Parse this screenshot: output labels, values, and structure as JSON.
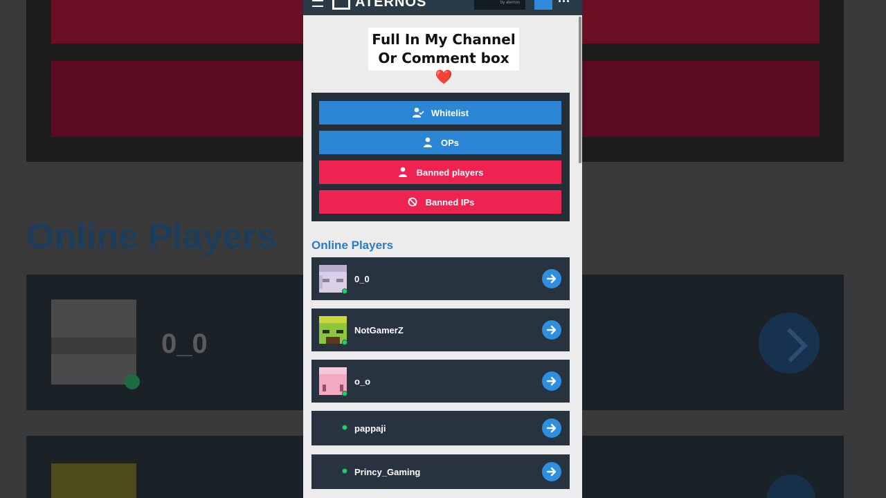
{
  "colors": {
    "panel_bg": "#ececec",
    "topbar_bg": "#2a3a46",
    "card_bg": "#27343f",
    "blue_accent": "#2b86d6",
    "red_accent": "#ef2352",
    "heading_blue": "#2a7cc7",
    "online_green": "#2ecc71"
  },
  "header": {
    "brand": "ATERNOS",
    "menu_icon": "hamburger-menu-icon",
    "logo_icon": "aternos-logo-icon",
    "more_icon": "more-dots-icon",
    "ad_text": "by aternos"
  },
  "banner": {
    "line1": "Full In My Channel",
    "line2": "Or Comment box",
    "emoji": "❤️"
  },
  "access": {
    "buttons": [
      {
        "label": "Whitelist",
        "icon": "user-check-icon",
        "color": "blue"
      },
      {
        "label": "OPs",
        "icon": "user-shield-icon",
        "color": "blue"
      },
      {
        "label": "Banned players",
        "icon": "user-ban-icon",
        "color": "red"
      },
      {
        "label": "Banned IPs",
        "icon": "ip-ban-icon",
        "color": "red"
      }
    ]
  },
  "online": {
    "heading": "Online Players",
    "players": [
      {
        "name": "0_0",
        "avatar": "pale-skin-avatar",
        "has_avatar": true
      },
      {
        "name": "NotGamerZ",
        "avatar": "green-skin-avatar",
        "has_avatar": true
      },
      {
        "name": "o_o",
        "avatar": "pink-skin-avatar",
        "has_avatar": true
      },
      {
        "name": "pappaji",
        "avatar": "",
        "has_avatar": false
      },
      {
        "name": "Princy_Gaming",
        "avatar": "",
        "has_avatar": false
      }
    ]
  },
  "background": {
    "heading": "Online Players",
    "player_name": "0_0"
  }
}
